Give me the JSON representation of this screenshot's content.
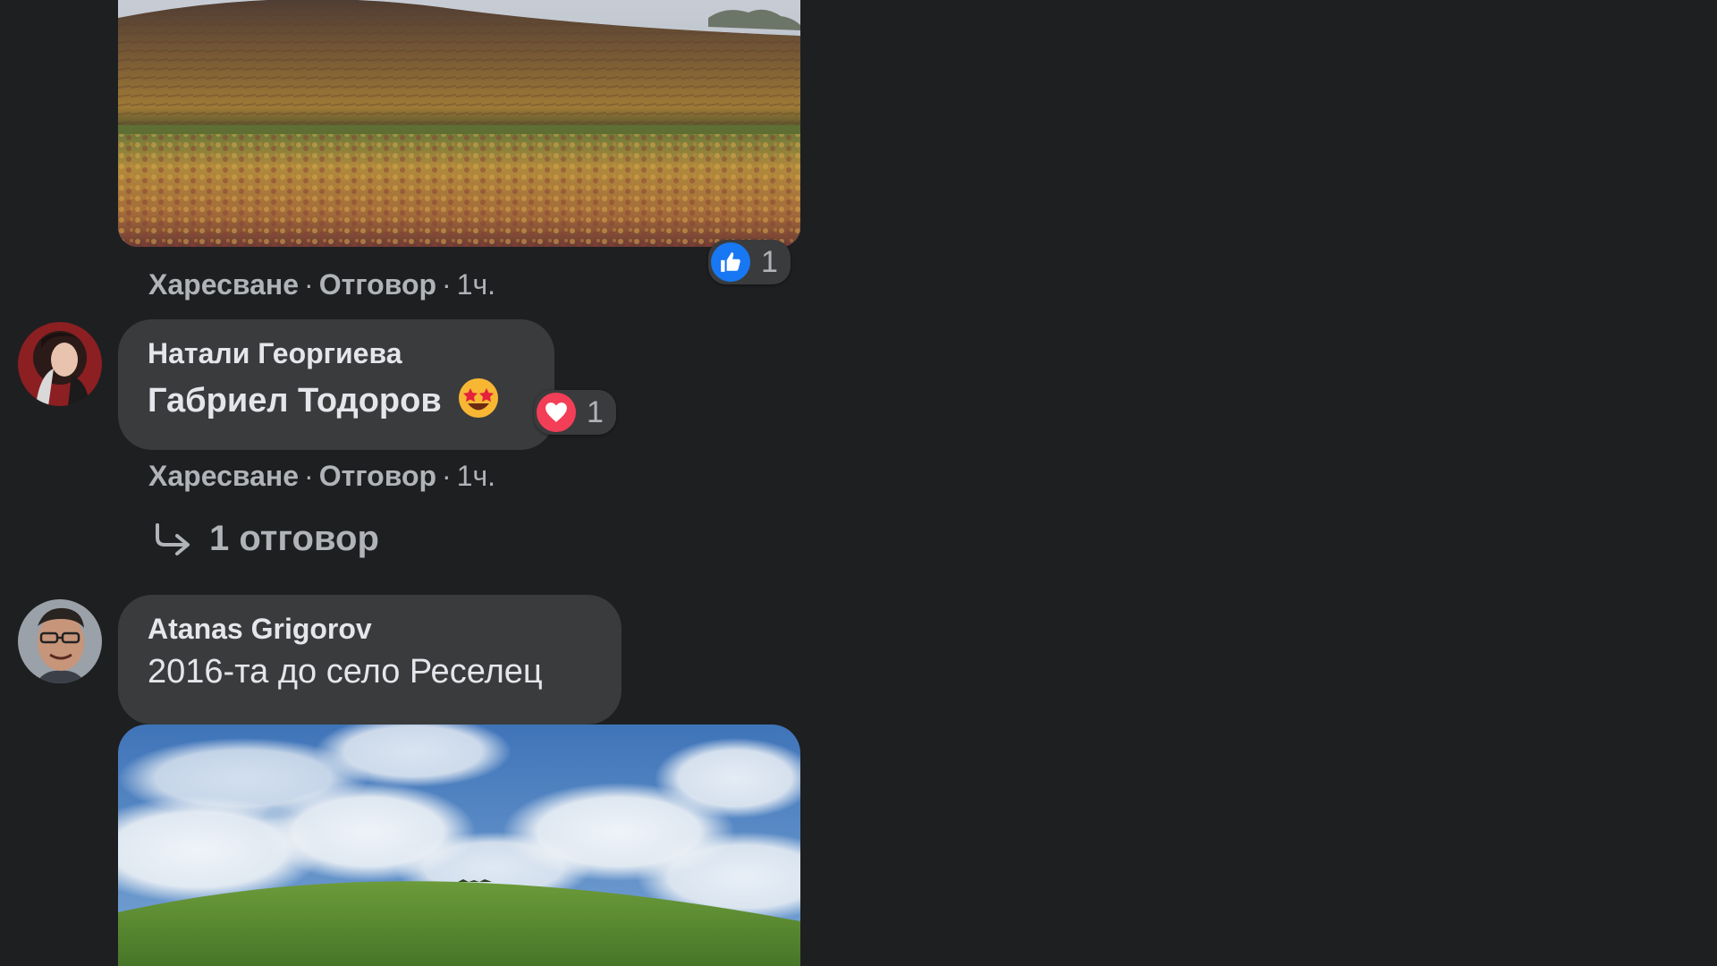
{
  "comment1": {
    "actions": {
      "like": "Харесване",
      "reply": "Отговор",
      "time": "1ч."
    },
    "reaction": {
      "icon": "like-icon",
      "count": "1",
      "color": "#1877f2"
    }
  },
  "comment2": {
    "author": "Натали Георгиева",
    "text": "Габриел Тодоров",
    "emoji": "star-struck-emoji",
    "reaction": {
      "icon": "heart-icon",
      "count": "1",
      "color": "#f33e58"
    },
    "actions": {
      "like": "Харесване",
      "reply": "Отговор",
      "time": "1ч."
    },
    "replies_link": "1 отговор"
  },
  "comment3": {
    "author": "Atanas Grigorov",
    "text": "2016-та до село Реселец"
  }
}
